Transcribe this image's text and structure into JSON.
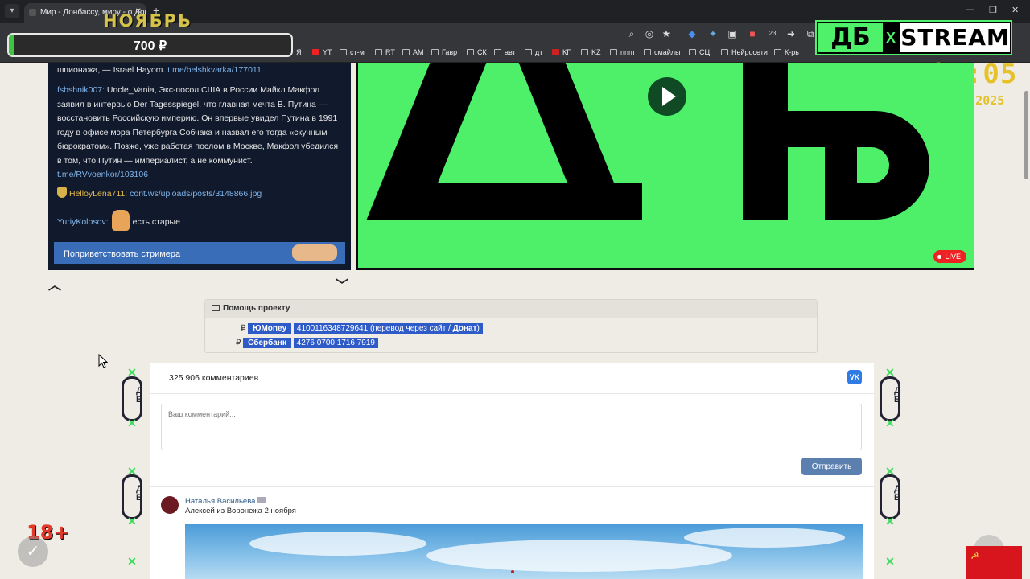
{
  "browser": {
    "tab_title": "Мир - Донбассу, миру - о Дон",
    "new_tab": "+",
    "bookmarks": [
      "Я",
      "YT",
      "ст-м",
      "RT",
      "АМ",
      "Гавр",
      "СК",
      "авт",
      "дт",
      "КП",
      "KZ",
      "nnm",
      "смайлы",
      "СЦ",
      "Нейросети",
      "К-рь"
    ],
    "extension_badge": "23"
  },
  "overlay": {
    "month": "НОЯБРЬ",
    "goal_amount": "700 ₽",
    "goal_progress": 0.02,
    "brand_mark": "ДБ",
    "brand_x": "X",
    "brand_text": "STREAM",
    "time": "21:05",
    "date": "03.11.2025",
    "age_rating": "18+",
    "accent_green": "#4ef06a",
    "clock_color": "#e5c22a"
  },
  "chat": {
    "messages": [
      {
        "text": "шпионажа, — Israel Hayom.",
        "link": "t.me/belshkvarka/177011"
      },
      {
        "author": "fsbshnik007:",
        "text": "Uncle_Vania, Экс-посол США в России Майкл Макфол заявил в интервью Der Tagesspiegel, что главная мечта В. Путина — восстановить Российскую империю. Он впервые увидел Путина в 1991 году в офисе мэра Петербурга Собчака и назвал его тогда «скучным бюрократом». Позже, уже работая послом в Москве, Макфол убедился в том, что Путин — империалист, а не коммунист.",
        "link": "t.me/RVvoenkor/103106"
      },
      {
        "author": "HelloyLena711:",
        "text": "",
        "link": "cont.ws/uploads/posts/3148866.jpg"
      },
      {
        "author": "YuriyKolosov:",
        "text": "есть старые",
        "link": ""
      }
    ],
    "greet_button": "Поприветствовать стримера"
  },
  "video": {
    "live_label": "LIVE"
  },
  "help": {
    "title": "Помощь проекту",
    "rows": [
      {
        "currency": "₽",
        "service": "ЮMoney",
        "details": "410011634872964​1 (перевод через сайт / ",
        "extra": "Донат",
        "tail": ")"
      },
      {
        "currency": "₽",
        "service": "Сбербанк",
        "details": "4276 0700 1716 7919",
        "extra": "",
        "tail": ""
      }
    ]
  },
  "comments": {
    "count": "325 906 комментариев",
    "vk_label": "VK",
    "placeholder": "Ваш комментарий...",
    "send_label": "Отправить",
    "first": {
      "author": "Наталья Васильева",
      "text": "Алексей из Воронежа 2 ноября"
    }
  }
}
